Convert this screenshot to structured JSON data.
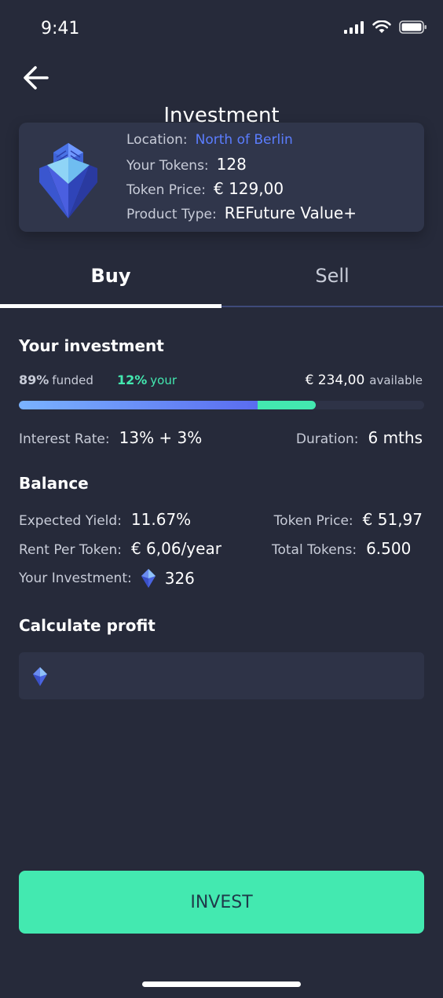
{
  "status_bar": {
    "time": "9:41"
  },
  "header": {
    "title": "Investment"
  },
  "card": {
    "location_label": "Location:",
    "location_value": "North of Berlin",
    "tokens_label": "Your Tokens:",
    "tokens_value": "128",
    "price_label": "Token Price:",
    "price_value": "€ 129,00",
    "type_label": "Product Type:",
    "type_value": "REFuture Value+"
  },
  "tabs": [
    {
      "label": "Buy",
      "active": true
    },
    {
      "label": "Sell",
      "active": false
    }
  ],
  "investment": {
    "title": "Your investment",
    "funded_pct": "89%",
    "funded_label": "funded",
    "your_pct": "12%",
    "your_label": "your",
    "available_amount": "€ 234,00",
    "available_label": "available",
    "progress_funded_fraction": 0.59,
    "progress_your_fraction": 0.143,
    "interest_label": "Interest Rate:",
    "interest_value": "13% + 3%",
    "duration_label": "Duration:",
    "duration_value": "6 mths"
  },
  "balance": {
    "title": "Balance",
    "yield_label": "Expected Yield:",
    "yield_value": "11.67%",
    "token_price_label": "Token Price:",
    "token_price_value": "€ 51,97",
    "rent_label": "Rent Per Token:",
    "rent_value": "€ 6,06/year",
    "total_tokens_label": "Total Tokens:",
    "total_tokens_value": "6.500",
    "your_investment_label": "Your Investment:",
    "your_investment_value": "326"
  },
  "calculate": {
    "title": "Calculate profit",
    "input_value": ""
  },
  "invest_button": {
    "label": "INVEST"
  },
  "colors": {
    "background": "#262a3a",
    "card": "#30364b",
    "accent_green": "#43e9b0",
    "accent_blue": "#5b7dff"
  }
}
